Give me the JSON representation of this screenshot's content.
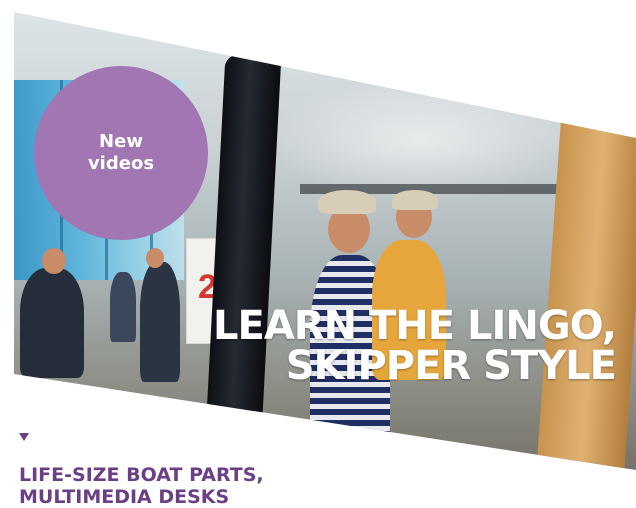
{
  "badge": {
    "line1": "New",
    "line2": "videos"
  },
  "headline": {
    "line1": "LEARN THE LINGO,",
    "line2": "SKIPPER STYLE"
  },
  "subheading": {
    "line1": "LIFE-SIZE BOAT PARTS,",
    "line2": "MULTIMEDIA DESKS"
  },
  "photo_sign_digit": "2",
  "colors": {
    "accent": "#a176b2",
    "heading": "#6a3f86",
    "headline_text": "#ffffff"
  },
  "icons": [
    "triangle-down-icon"
  ]
}
